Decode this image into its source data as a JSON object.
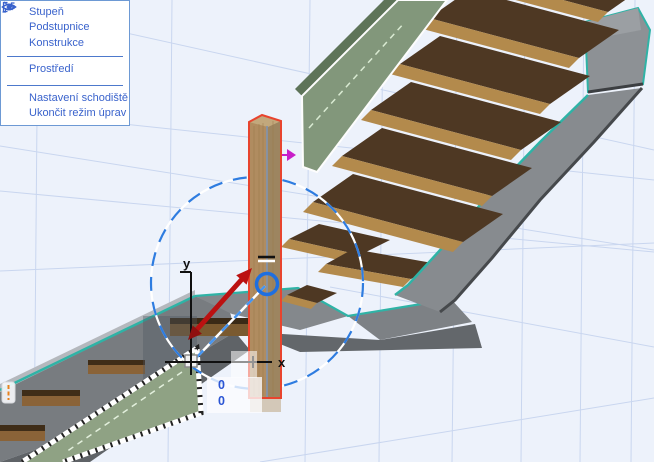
{
  "panel": {
    "visibility_items": [
      {
        "label": "Stupeň",
        "icon": "eye-icon"
      },
      {
        "label": "Podstupnice",
        "icon": "eye-icon"
      },
      {
        "label": "Konstrukce",
        "icon": "eye-icon"
      }
    ],
    "environment_item": {
      "label": "Prostředí",
      "icon": "eye-icon"
    },
    "actions": [
      {
        "label": "Nastavení schodiště",
        "icon": "stair-settings-icon"
      },
      {
        "label": "Ukončit režim úprav",
        "icon": "exit-icon"
      }
    ]
  },
  "tracker": {
    "x_value": "0",
    "y_value": "0"
  },
  "axes": {
    "x_label": "x",
    "y_label": "y"
  },
  "colors": {
    "accent_blue": "#3a63cc",
    "selection_red": "#e8442e",
    "edge_teal": "#2fb3a6",
    "guide_blue": "#2e7ce0",
    "panel_green": "#82977b",
    "wood_gold": "#b38a4c",
    "wood_dark": "#4e3823",
    "stringer_gray": "#878b8f",
    "marker_magenta": "#c81ec8",
    "marker_orange": "#e8821e"
  }
}
